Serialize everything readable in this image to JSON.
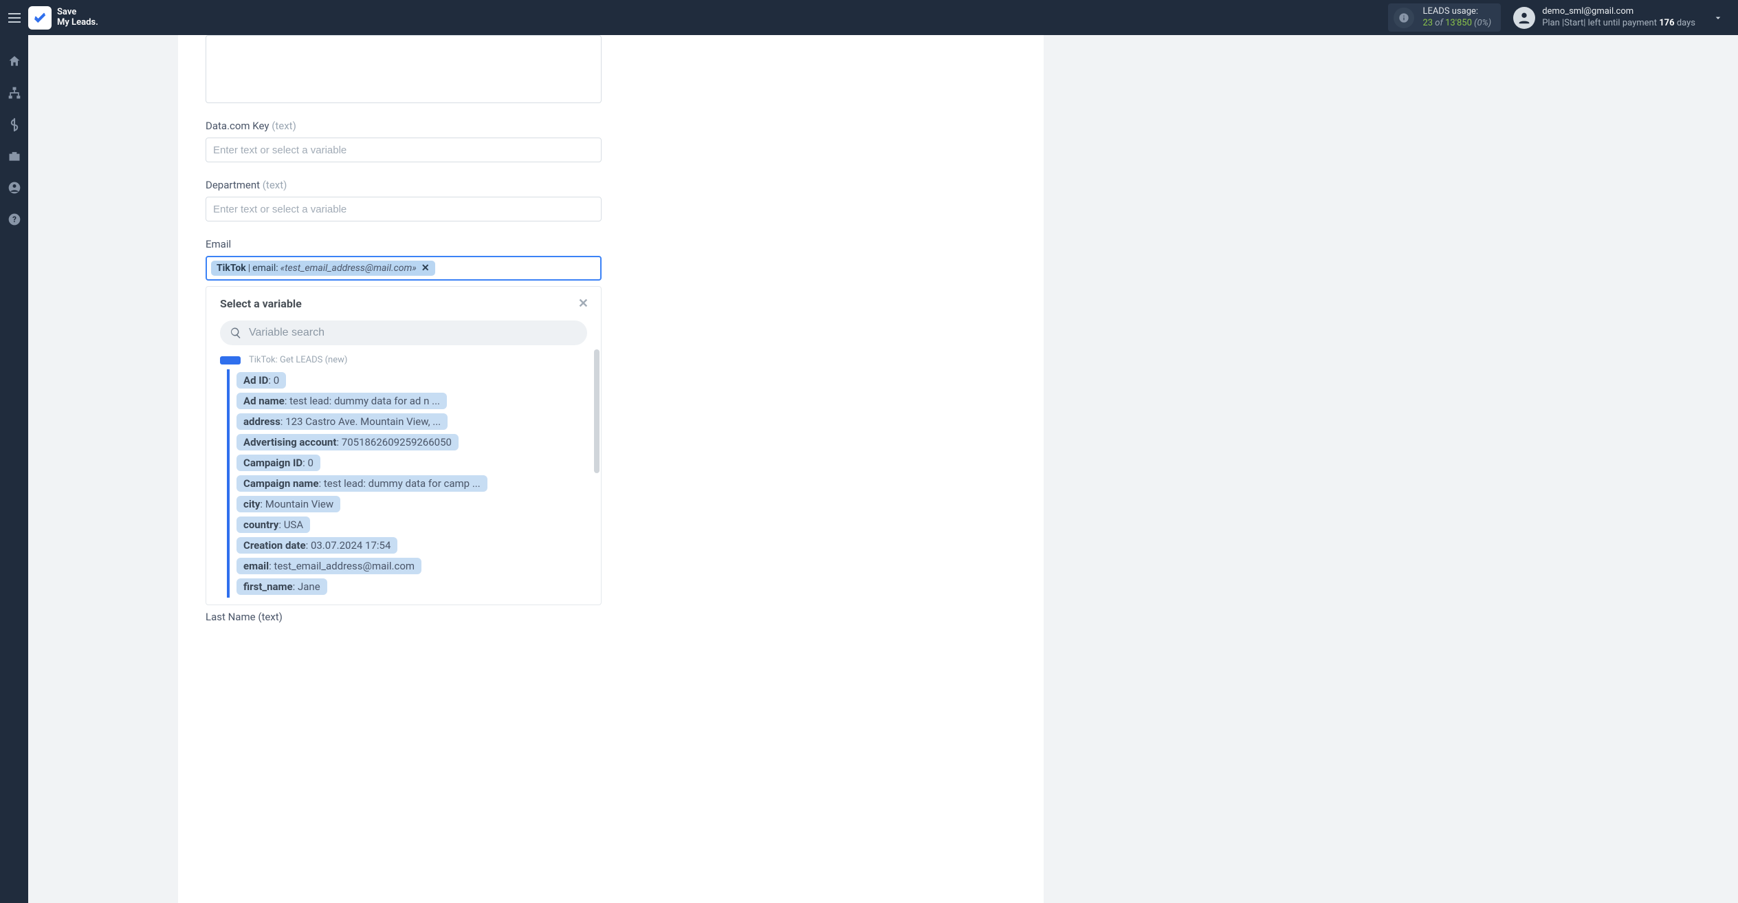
{
  "brand": {
    "line1": "Save",
    "line2": "My Leads."
  },
  "usage": {
    "label": "LEADS usage:",
    "used": "23",
    "of_word": "of",
    "total": "13'850",
    "pct": "(0%)"
  },
  "account": {
    "email": "demo_sml@gmail.com",
    "sub_prefix": "Plan |Start| left until payment ",
    "days": "176",
    "sub_suffix": " days"
  },
  "fields": {
    "placeholder": "Enter text or select a variable",
    "datacom": {
      "label": "Data.com Key",
      "hint": "(text)"
    },
    "department": {
      "label": "Department",
      "hint": "(text)"
    },
    "email": {
      "label": "Email"
    },
    "last_name": {
      "label": "Last Name",
      "hint": "(text)"
    }
  },
  "chip": {
    "source": "TikTok",
    "pipe": " | ",
    "field": "email: ",
    "value": "«test_email_address@mail.com»"
  },
  "dropdown": {
    "title": "Select a variable",
    "search_placeholder": "Variable search",
    "source_label": "TikTok: Get LEADS (new)",
    "vars": [
      {
        "name": "Ad ID",
        "value": ": 0"
      },
      {
        "name": "Ad name",
        "value": ": test lead: dummy data for ad n ..."
      },
      {
        "name": "address",
        "value": ": 123 Castro Ave. Mountain View, ..."
      },
      {
        "name": "Advertising account",
        "value": ": 7051862609259266050"
      },
      {
        "name": "Campaign ID",
        "value": ": 0"
      },
      {
        "name": "Campaign name",
        "value": ": test lead: dummy data for camp ..."
      },
      {
        "name": "city",
        "value": ": Mountain View"
      },
      {
        "name": "country",
        "value": ": USA"
      },
      {
        "name": "Creation date",
        "value": ": 03.07.2024 17:54"
      },
      {
        "name": "email",
        "value": ": test_email_address@mail.com"
      },
      {
        "name": "first_name",
        "value": ": Jane"
      }
    ]
  }
}
